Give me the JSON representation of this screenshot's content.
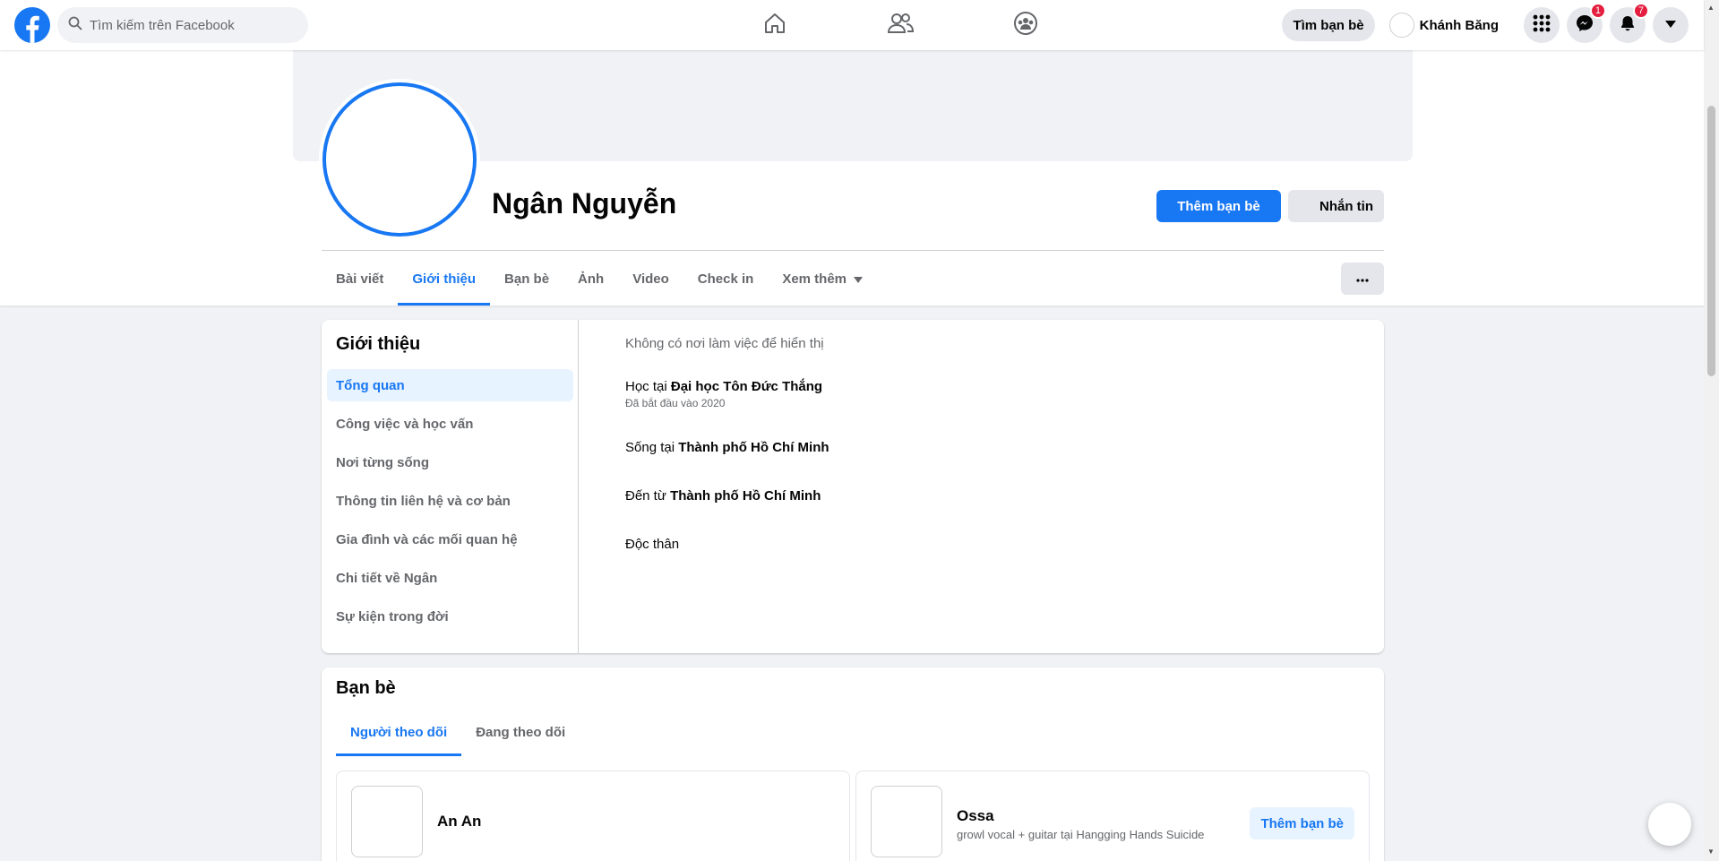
{
  "nav": {
    "search_placeholder": "Tìm kiếm trên Facebook",
    "find_friends": "Tìm bạn bè",
    "me_name": "Khánh Băng",
    "messenger_badge": "1",
    "notifications_badge": "7"
  },
  "profile": {
    "name": "Ngân Nguyễn",
    "add_friend": "Thêm bạn bè",
    "message": "Nhắn tin",
    "tabs": [
      {
        "label": "Bài viết"
      },
      {
        "label": "Giới thiệu"
      },
      {
        "label": "Bạn bè"
      },
      {
        "label": "Ảnh"
      },
      {
        "label": "Video"
      },
      {
        "label": "Check in"
      },
      {
        "label": "Xem thêm"
      }
    ],
    "more_label": "···"
  },
  "about": {
    "title": "Giới thiệu",
    "menu": [
      {
        "label": "Tổng quan"
      },
      {
        "label": "Công việc và học vấn"
      },
      {
        "label": "Nơi từng sống"
      },
      {
        "label": "Thông tin liên hệ và cơ bản"
      },
      {
        "label": "Gia đình và các mối quan hệ"
      },
      {
        "label": "Chi tiết về Ngân"
      },
      {
        "label": "Sự kiện trong đời"
      }
    ],
    "no_work": "Không có nơi làm việc để hiển thị",
    "study_prefix": "Học tại ",
    "study_place": "Đại học Tôn Đức Thắng",
    "study_since": "Đã bắt đầu vào 2020",
    "lives_prefix": "Sống tại ",
    "lives_place": "Thành phố Hồ Chí Minh",
    "from_prefix": "Đến từ ",
    "from_place": "Thành phố Hồ Chí Minh",
    "relationship": "Độc thân"
  },
  "friends": {
    "title": "Bạn bè",
    "tabs": [
      {
        "label": "Người theo dõi"
      },
      {
        "label": "Đang theo dõi"
      }
    ],
    "items": [
      {
        "name": "An An",
        "subtitle": ""
      },
      {
        "name": "Ossa",
        "subtitle": "growl vocal + guitar tại Hangging Hands Suicide",
        "action": "Thêm bạn bè"
      }
    ]
  },
  "colors": {
    "brand_blue": "#1877f2",
    "page_bg": "#f0f2f5",
    "badge_red": "#e41e3f"
  },
  "icons": [
    "facebook-logo-icon",
    "search-icon",
    "home-icon",
    "friends-icon",
    "groups-icon",
    "menu-grid-icon",
    "messenger-icon",
    "bell-icon",
    "caret-down-icon"
  ]
}
